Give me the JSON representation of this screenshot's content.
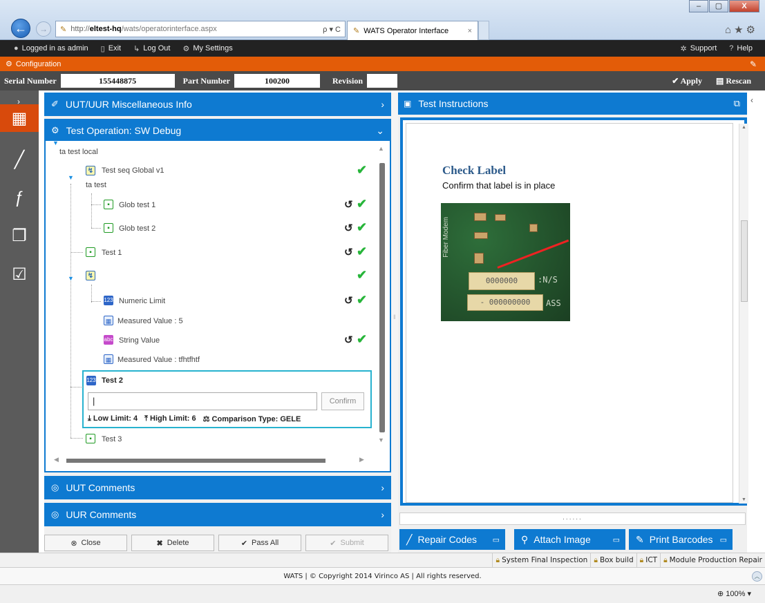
{
  "browser": {
    "url_host": "eltest-hq",
    "url_prefix": "http://",
    "url_rest": "/wats/operatorinterface.aspx",
    "url_controls": "ρ ▾ C",
    "tab_title": "WATS Operator Interface",
    "tab_close": "×",
    "right_icons": "⌂★⚙"
  },
  "window": {
    "minimize": "–",
    "maximize": "▢",
    "close": "X"
  },
  "toolbar": {
    "logged_in": "Logged in as admin",
    "exit": "Exit",
    "logout": "Log Out",
    "settings": "My Settings",
    "support": "Support",
    "help": "Help"
  },
  "config_bar": {
    "label": "Configuration"
  },
  "unit": {
    "serial_label": "Serial Number",
    "serial_value": "155448875",
    "part_label": "Part Number",
    "part_value": "100200",
    "revision_label": "Revision",
    "revision_value": "",
    "apply": "Apply",
    "rescan": "Rescan"
  },
  "left": {
    "misc_header": "UUT/UUR Miscellaneous Info",
    "testop_header": "Test Operation: SW Debug",
    "comments_uut": "UUT Comments",
    "comments_uur": "UUR Comments"
  },
  "tree": {
    "root_label": "ta test local",
    "seq_global": "Test seq Global v1",
    "ta_test": "ta test",
    "glob1": "Glob test 1",
    "glob2": "Glob test 2",
    "test1": "Test 1",
    "numeric": "Numeric Limit",
    "meas1": "Measured Value : 5",
    "string": "String Value",
    "meas2": "Measured Value : tfhtfhtf",
    "test2": "Test 2",
    "test3": "Test 3"
  },
  "test2": {
    "input_value": "|",
    "confirm": "Confirm",
    "low_limit": "Low Limit: 4",
    "high_limit": "High Limit: 6",
    "comparison": "Comparison Type: GELE"
  },
  "actions": {
    "close": "Close",
    "delete": "Delete",
    "pass_all": "Pass All",
    "submit": "Submit"
  },
  "instructions": {
    "header": "Test Instructions",
    "title": "Check Label",
    "text": "Confirm that label is in place",
    "dots": "......",
    "pcb_label1": "0000000",
    "pcb_label2": "- 000000000",
    "pcb_text1": ":N/S",
    "pcb_text2": "ASS",
    "pcb_side": "Fiber Modem"
  },
  "right_buttons": {
    "repair": "Repair Codes",
    "attach": "Attach Image",
    "print": "Print Barcodes"
  },
  "stations": [
    "System Final Inspection",
    "Box build",
    "ICT",
    "Module Production Repair"
  ],
  "footer": {
    "text": "WATS | © Copyright 2014 Virinco AS | All rights reserved."
  },
  "status": {
    "zoom": "100%"
  },
  "colors": {
    "accent_blue": "#0e7ad1",
    "config_orange": "#e35c08",
    "check_green": "#27b53a",
    "active_teal": "#27b2cf"
  }
}
